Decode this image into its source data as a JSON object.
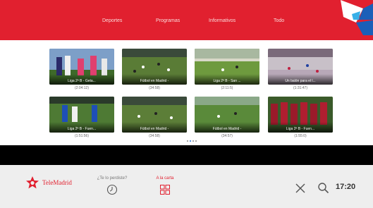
{
  "nav": {
    "items": [
      "Deportes",
      "Programas",
      "Informativos",
      "Todo"
    ]
  },
  "videos": [
    {
      "title": "Liga 2ª B - Geta...",
      "duration": "(2:04:12)",
      "scene": "players"
    },
    {
      "title": "Fútbol en Madrid -",
      "duration": "(34:58)",
      "scene": "pitch"
    },
    {
      "title": "Liga 2ª B - San ...",
      "duration": "(2:11:5)",
      "scene": "pitch"
    },
    {
      "title": "Un balón para el l...",
      "duration": "(1:31:47)",
      "scene": "indoor"
    },
    {
      "title": "Liga 2ª B - Fuen...",
      "duration": "(1:51:56)",
      "scene": "players"
    },
    {
      "title": "Fútbol en Madrid -",
      "duration": "(34:58)",
      "scene": "pitch"
    },
    {
      "title": "Fútbol en Madrid -",
      "duration": "(34:57)",
      "scene": "pitch"
    },
    {
      "title": "Liga 2ª B - Fuen...",
      "duration": "(1:55:0)",
      "scene": "team"
    }
  ],
  "pager": {
    "pages": 4,
    "current": 1
  },
  "bottom": {
    "brand": "TeleMadrid",
    "missed_label": "¿Te lo perdiste?",
    "carta_label": "A la carta",
    "time": "17:20"
  },
  "icons": {
    "brand": "telemadrid-star-icon",
    "missed": "clock-icon",
    "carta": "grid-icon",
    "close": "close-icon",
    "search": "search-icon"
  },
  "colors": {
    "brand_red": "#e1202f",
    "panel": "#ffffff",
    "bottom_bar": "#eeeeee",
    "page_bg": "#000000",
    "pager_active": "#1e6fd9"
  }
}
